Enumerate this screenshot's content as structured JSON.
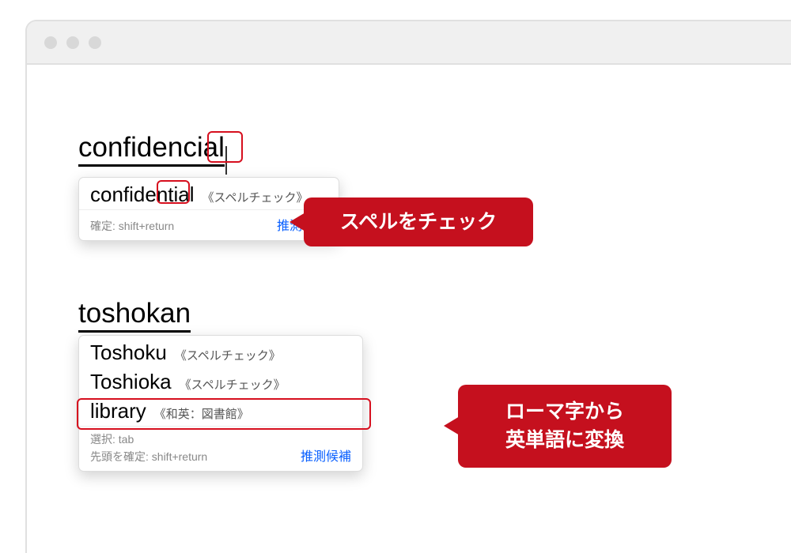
{
  "example1": {
    "typed": "confidencial",
    "candidate": {
      "word": "confidential",
      "note": "《スペルチェック》"
    },
    "foot": {
      "confirm": "確定: shift+return",
      "suggest": "推測候補"
    },
    "callout": "スペルをチェック"
  },
  "example2": {
    "typed": "toshokan",
    "candidates": [
      {
        "word": "Toshoku",
        "note": "《スペルチェック》"
      },
      {
        "word": "Toshioka",
        "note": "《スペルチェック》"
      },
      {
        "word": "library",
        "note": "《和英：図書館》"
      }
    ],
    "foot": {
      "select": "選択: tab",
      "confirm": "先頭を確定: shift+return",
      "suggest": "推測候補"
    },
    "callout_line1": "ローマ字から",
    "callout_line2": "英単語に変換"
  }
}
